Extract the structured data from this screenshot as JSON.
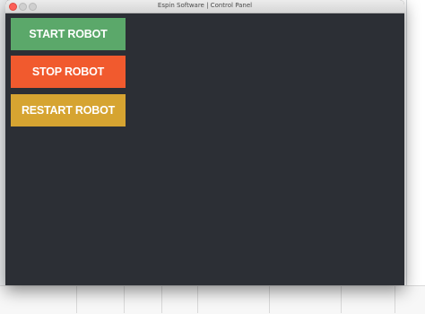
{
  "window": {
    "title": "Espin Software | Control Panel"
  },
  "controls": {
    "start_label": "START ROBOT",
    "stop_label": "STOP ROBOT",
    "restart_label": "RESTART ROBOT"
  },
  "colors": {
    "window_bg": "#2c2f35",
    "start": "#5ba86a",
    "stop": "#f15a2e",
    "restart": "#d6a431"
  }
}
